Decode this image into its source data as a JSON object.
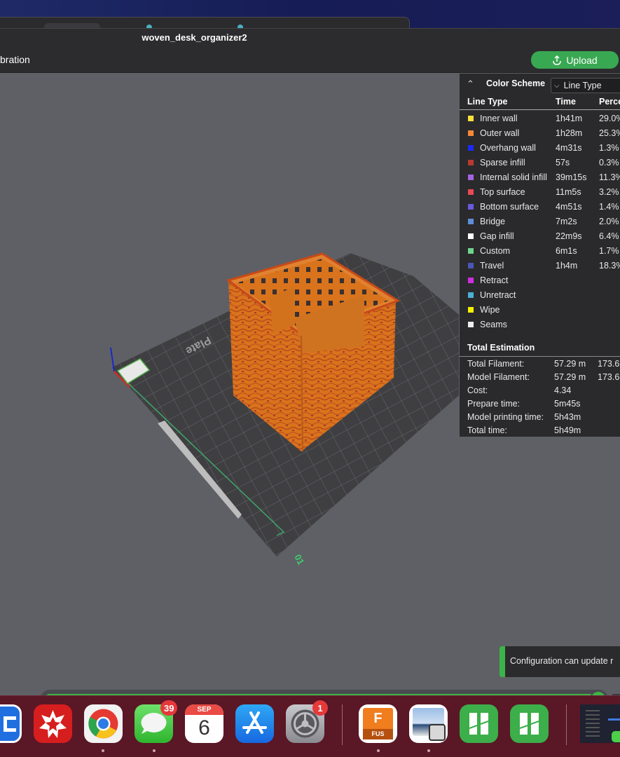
{
  "window": {
    "title": "woven_desk_organizer2",
    "toolbar_left_text": "bration",
    "upload_label": "Upload"
  },
  "legend": {
    "color_scheme_label": "Color Scheme",
    "selected_scheme": "Line Type",
    "columns": [
      "Line Type",
      "Time",
      "Perce"
    ],
    "rows": [
      {
        "name": "Inner wall",
        "time": "1h41m",
        "percent": "29.0%",
        "color": "#f7e03a"
      },
      {
        "name": "Outer wall",
        "time": "1h28m",
        "percent": "25.3%",
        "color": "#f5883a"
      },
      {
        "name": "Overhang wall",
        "time": "4m31s",
        "percent": "1.3%",
        "color": "#1a2af5"
      },
      {
        "name": "Sparse infill",
        "time": "57s",
        "percent": "0.3%",
        "color": "#b83a30"
      },
      {
        "name": "Internal solid infill",
        "time": "39m15s",
        "percent": "11.3%",
        "color": "#a364e0"
      },
      {
        "name": "Top surface",
        "time": "11m5s",
        "percent": "3.2%",
        "color": "#e84a55"
      },
      {
        "name": "Bottom surface",
        "time": "4m51s",
        "percent": "1.4%",
        "color": "#6a5adf"
      },
      {
        "name": "Bridge",
        "time": "7m2s",
        "percent": "2.0%",
        "color": "#5f8ed8"
      },
      {
        "name": "Gap infill",
        "time": "22m9s",
        "percent": "6.4%",
        "color": "#ffffff"
      },
      {
        "name": "Custom",
        "time": "6m1s",
        "percent": "1.7%",
        "color": "#6fd38f"
      },
      {
        "name": "Travel",
        "time": "1h4m",
        "percent": "18.3%",
        "color": "#4a55b8"
      },
      {
        "name": "Retract",
        "time": "",
        "percent": "",
        "color": "#d02ee0"
      },
      {
        "name": "Unretract",
        "time": "",
        "percent": "",
        "color": "#4ab0d5"
      },
      {
        "name": "Wipe",
        "time": "",
        "percent": "",
        "color": "#f5f000"
      },
      {
        "name": "Seams",
        "time": "",
        "percent": "",
        "color": "#eeeeee"
      }
    ],
    "total_estimation_label": "Total Estimation",
    "estimation": [
      {
        "label": "Total Filament:",
        "value": "57.29 m",
        "extra": "173.6"
      },
      {
        "label": "Model Filament:",
        "value": "57.29 m",
        "extra": "173.6"
      },
      {
        "label": "Cost:",
        "value": "4.34",
        "extra": ""
      },
      {
        "label": "Prepare time:",
        "value": "5m45s",
        "extra": ""
      },
      {
        "label": "Model printing time:",
        "value": "5h43m",
        "extra": ""
      },
      {
        "label": "Total time:",
        "value": "5h49m",
        "extra": ""
      }
    ]
  },
  "scene": {
    "plate_label": "Plate",
    "plate_number": "01",
    "model_color": "#d9731c"
  },
  "notification": {
    "text": "Configuration can update r"
  },
  "layer_slider": {
    "progress": 1.0
  },
  "dock": {
    "messages_badge": "39",
    "settings_badge": "1",
    "calendar_month": "SEP",
    "calendar_day": "6",
    "fusion_label": "FUS",
    "fusion_letter": "F"
  }
}
